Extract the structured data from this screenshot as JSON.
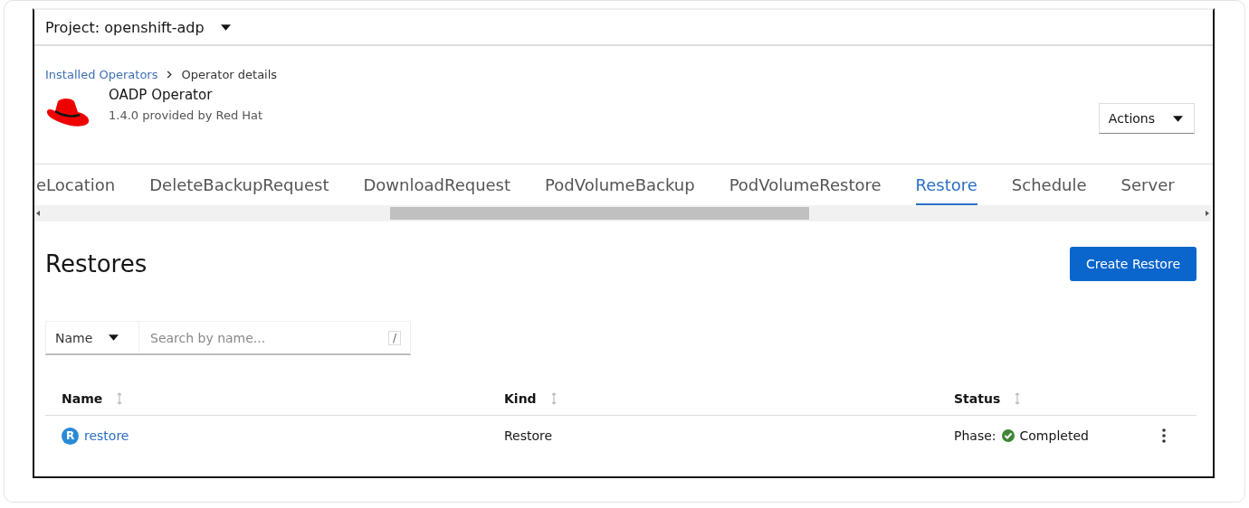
{
  "project": {
    "label": "Project: openshift-adp"
  },
  "breadcrumb": [
    {
      "label": "Installed Operators",
      "kind": "link"
    },
    {
      "label": "Operator details",
      "kind": "current"
    }
  ],
  "operator": {
    "name": "OADP Operator",
    "subtitle": "1.4.0 provided by Red Hat"
  },
  "actions": {
    "label": "Actions"
  },
  "tabs": [
    {
      "label": "eLocation",
      "selected": false
    },
    {
      "label": "DeleteBackupRequest",
      "selected": false
    },
    {
      "label": "DownloadRequest",
      "selected": false
    },
    {
      "label": "PodVolumeBackup",
      "selected": false
    },
    {
      "label": "PodVolumeRestore",
      "selected": false
    },
    {
      "label": "Restore",
      "selected": true
    },
    {
      "label": "Schedule",
      "selected": false
    },
    {
      "label": "Server",
      "selected": false
    }
  ],
  "page_title": "Restores",
  "create_button": "Create Restore",
  "filter": {
    "type": "Name",
    "placeholder": "Search by name...",
    "shortcut": "/"
  },
  "table": {
    "columns": [
      "Name",
      "Kind",
      "Status"
    ],
    "rows": [
      {
        "badge": "R",
        "name": "restore",
        "kind": "Restore",
        "phase_label": "Phase:",
        "status": "Completed"
      }
    ]
  }
}
